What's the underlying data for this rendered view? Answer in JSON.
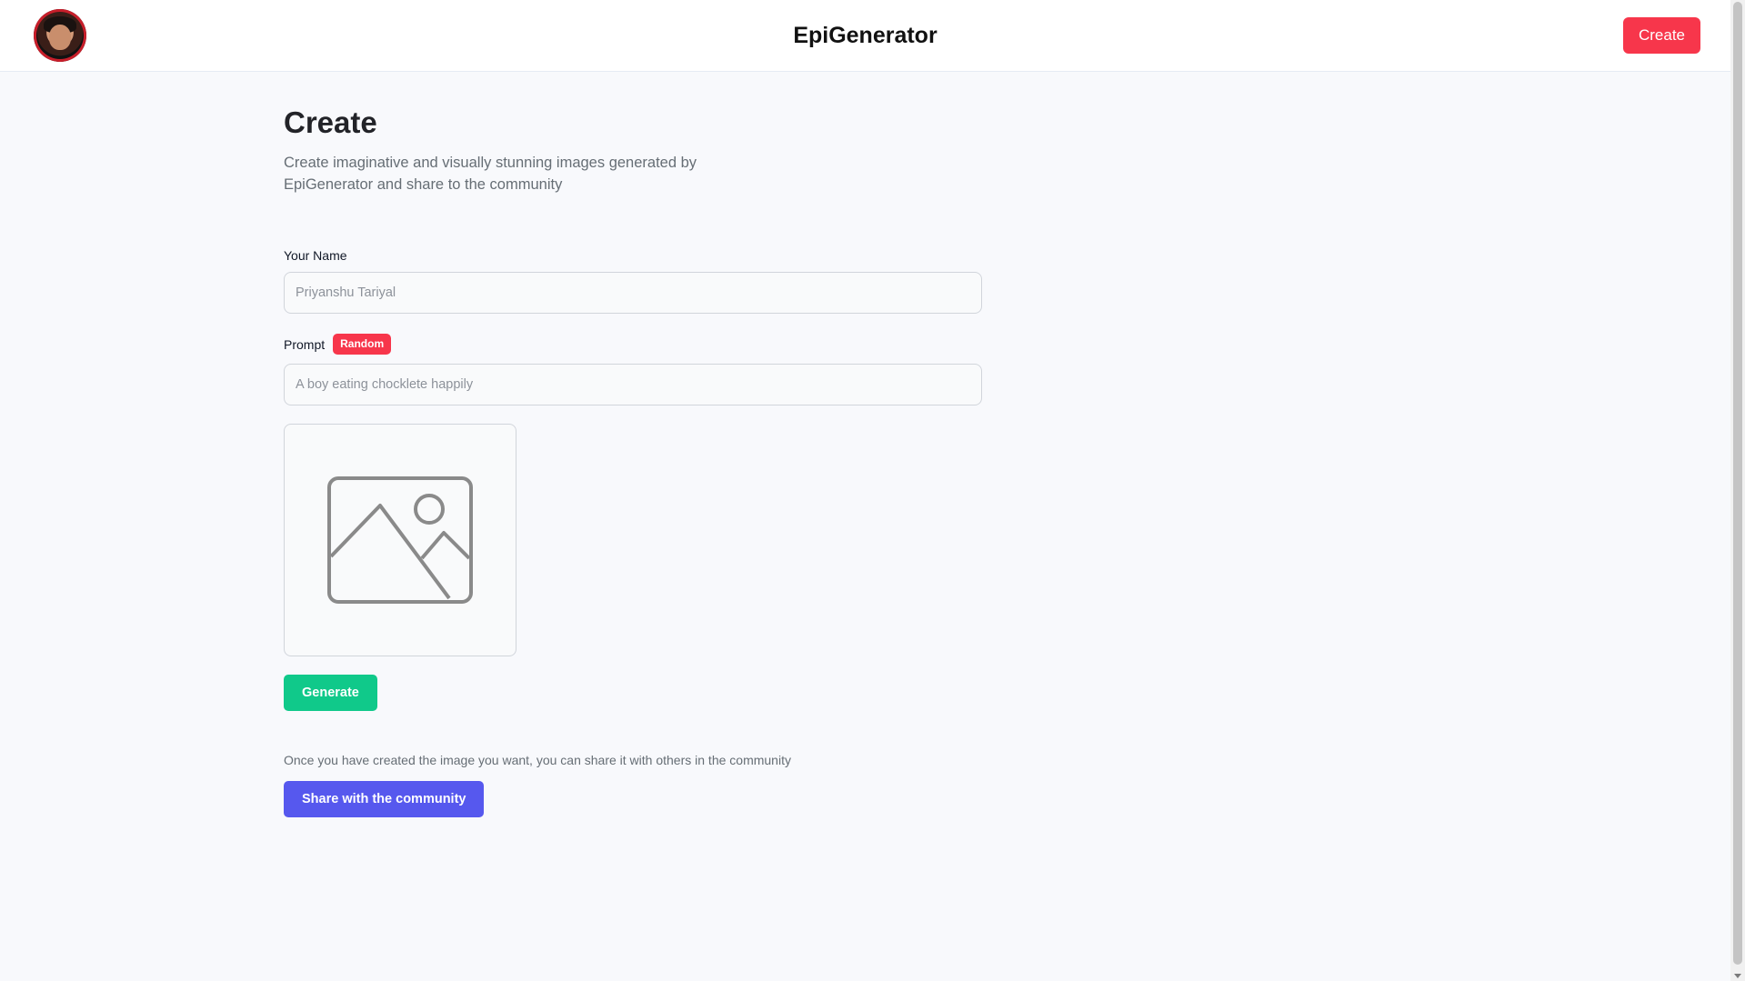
{
  "header": {
    "title": "EpiGenerator",
    "create_label": "Create"
  },
  "main": {
    "title": "Create",
    "subtitle": "Create imaginative and visually stunning images generated by EpiGenerator and share to the community",
    "name_field": {
      "label": "Your Name",
      "placeholder": "Priyanshu Tariyal"
    },
    "prompt_field": {
      "label": "Prompt",
      "random_label": "Random",
      "placeholder": "A boy eating chocklete happily"
    },
    "preview": {
      "icon": "image-placeholder-icon"
    },
    "generate_label": "Generate",
    "share_note": "Once you have created the image you want, you can share it with others in the community",
    "share_label": "Share with the community"
  },
  "colors": {
    "accent_red": "#f7364b",
    "generate_green": "#10c98a",
    "share_blue": "#5658ee"
  }
}
